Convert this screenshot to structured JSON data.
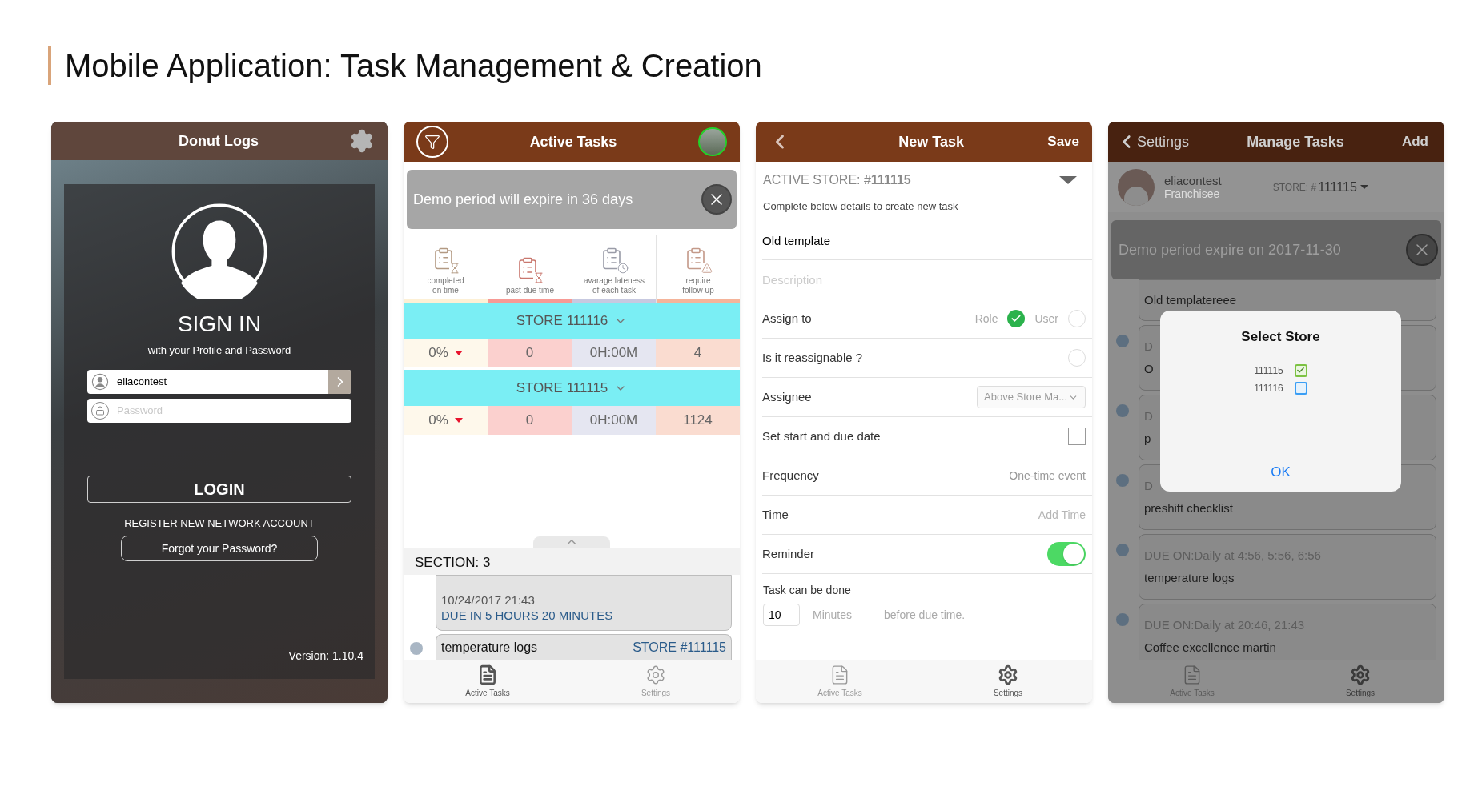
{
  "title": "Mobile Application: Task Management & Creation",
  "login_screen": {
    "header_title": "Donut Logs",
    "heading": "SIGN IN",
    "subtitle": "with your Profile and Password",
    "username": {
      "value": "eliacontest"
    },
    "password": {
      "placeholder": "Password"
    },
    "login_button": "LOGIN",
    "register_link": "REGISTER NEW NETWORK ACCOUNT",
    "forgot_button": "Forgot your Password?",
    "version": "Version: 1.10.4"
  },
  "active_tasks_screen": {
    "header_title": "Active Tasks",
    "banner": "Demo period will expire in 36 days",
    "metrics": [
      {
        "label": "completed\non time",
        "kind": "hourglass",
        "color": "#fdf0d5"
      },
      {
        "label": "past due time",
        "kind": "hourglass",
        "color": "#f79a95"
      },
      {
        "label": "avarage lateness\nof each task",
        "kind": "clock",
        "color": "#c7c9e0"
      },
      {
        "label": "require\nfollow up",
        "kind": "alert",
        "color": "#f5b49a"
      }
    ],
    "stores": [
      {
        "name": "STORE 111116",
        "cells": [
          {
            "text": "0%",
            "decline": true
          },
          {
            "text": "0"
          },
          {
            "text": "0H:00M"
          },
          {
            "text": "4"
          }
        ]
      },
      {
        "name": "STORE 111115",
        "cells": [
          {
            "text": "0%",
            "decline": true
          },
          {
            "text": "0"
          },
          {
            "text": "0H:00M"
          },
          {
            "text": "1124"
          }
        ]
      }
    ],
    "section": "SECTION: 3",
    "current_card": {
      "date": "10/24/2017 21:43",
      "due": "DUE IN 5 HOURS 20 MINUTES"
    },
    "next_card": {
      "name": "temperature logs",
      "store": "STORE #111115"
    },
    "tabs": [
      {
        "kind": "tasks",
        "label": "Active Tasks",
        "selected": true
      },
      {
        "kind": "settings",
        "label": "Settings",
        "selected": false
      }
    ]
  },
  "new_task_screen": {
    "header_title": "New Task",
    "action": "Save",
    "active_store": "ACTIVE STORE: #**111115**",
    "instruction": "Complete below details to create new task",
    "fields": [
      {
        "kind": "text",
        "value": "Old template"
      },
      {
        "kind": "text",
        "placeholder": "Description"
      },
      {
        "kind": "choice",
        "label": "Assign to",
        "options": [
          {
            "label": "Role",
            "selected": true
          },
          {
            "label": "User",
            "selected": false
          }
        ]
      },
      {
        "kind": "radio",
        "label": "Is it reassignable ?",
        "checked": false
      },
      {
        "kind": "select",
        "label": "Assignee",
        "value": "Above Store Ma..."
      },
      {
        "kind": "checkbox",
        "label": "Set start and due date",
        "checked": false
      },
      {
        "kind": "value",
        "label": "Frequency",
        "value": "One-time event"
      },
      {
        "kind": "value",
        "label": "Time",
        "placeholder": "Add Time"
      },
      {
        "kind": "switch",
        "label": "Reminder",
        "on": true
      }
    ],
    "done_before": {
      "label": "Task can be done",
      "value": "10",
      "unit": "Minutes",
      "suffix": "before due time."
    },
    "tabs": [
      {
        "kind": "tasks",
        "label": "Active Tasks",
        "selected": false
      },
      {
        "kind": "settings",
        "label": "Settings",
        "selected": true
      }
    ]
  },
  "manage_tasks_screen": {
    "back": "Settings",
    "header_title": "Manage Tasks",
    "action": "Add",
    "profile": {
      "name": "eliacontest",
      "role": "Franchisee",
      "store_label": "STORE: #",
      "store": "111115"
    },
    "banner": "Demo period expire on 2017-11-30",
    "tasks": [
      {
        "name": "Old templatereee"
      },
      {
        "due": "D",
        "name": "O"
      },
      {
        "due": "D",
        "name": "p"
      },
      {
        "due": "D",
        "name": "preshift checklist"
      },
      {
        "due": "DUE ON:Daily at 4:56, 5:56, 6:56",
        "name": "temperature logs"
      },
      {
        "due": "DUE ON:Daily at 20:46, 21:43",
        "name": "Coffee excellence martin"
      }
    ],
    "dialog": {
      "title": "Select Store",
      "options": [
        {
          "label": "111115",
          "checked": true
        },
        {
          "label": "111116",
          "checked": false
        }
      ],
      "button": "OK"
    },
    "tabs": [
      {
        "kind": "tasks",
        "label": "Active Tasks",
        "selected": false
      },
      {
        "kind": "settings",
        "label": "Settings",
        "selected": true
      }
    ]
  }
}
